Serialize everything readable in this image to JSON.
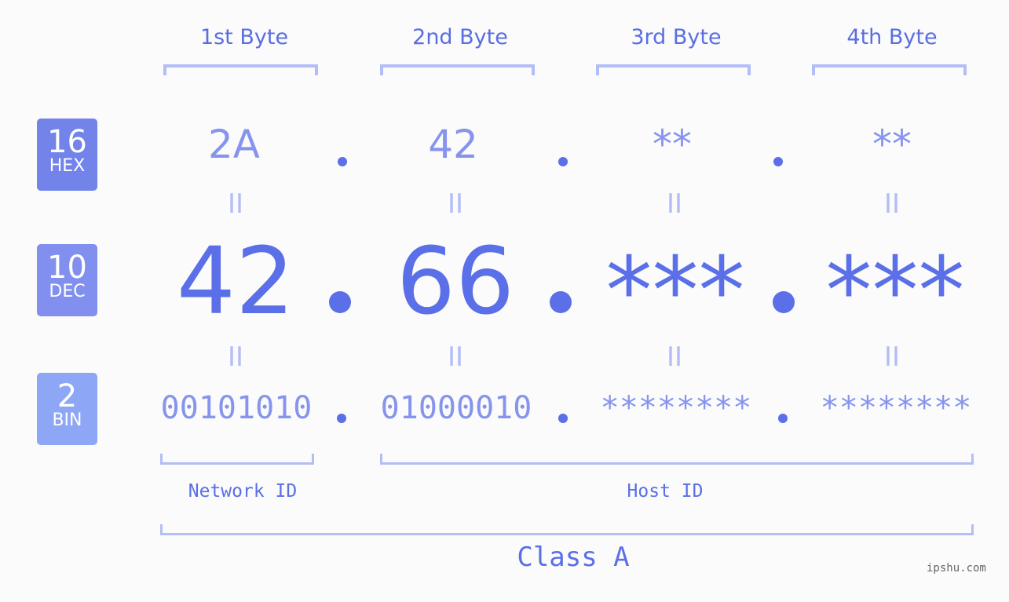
{
  "headers": [
    "1st Byte",
    "2nd Byte",
    "3rd Byte",
    "4th Byte"
  ],
  "badges": [
    {
      "num": "16",
      "label": "HEX",
      "color": "#7283ea"
    },
    {
      "num": "10",
      "label": "DEC",
      "color": "#8190ef"
    },
    {
      "num": "2",
      "label": "BIN",
      "color": "#8ea6f6"
    }
  ],
  "hex": [
    "2A",
    "42",
    "**",
    "**"
  ],
  "dec": [
    "42",
    "66",
    "***",
    "***"
  ],
  "bin": [
    "00101010",
    "01000010",
    "********",
    "********"
  ],
  "equals_sign": "II",
  "network_id_label": "Network ID",
  "host_id_label": "Host ID",
  "class_label": "Class A",
  "watermark": "ipshu.com",
  "colors": {
    "accent": "#5a6fe8",
    "light_accent": "#8694ee",
    "bracket": "#b3bdf7",
    "background": "#fafbfa"
  }
}
